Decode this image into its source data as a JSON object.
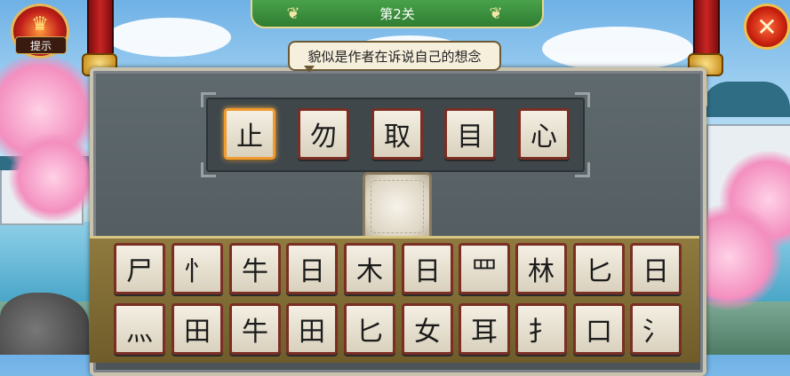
{
  "level": {
    "title": "第2关"
  },
  "hint": {
    "text": "貌似是作者在诉说自己的想念"
  },
  "tip_button": {
    "label": "提示",
    "icon": "trophy-icon"
  },
  "close_button": {
    "icon": "close-icon",
    "glyph": "✕"
  },
  "clue_tiles": [
    {
      "char": "止",
      "selected": true
    },
    {
      "char": "勿",
      "selected": false
    },
    {
      "char": "取",
      "selected": false
    },
    {
      "char": "目",
      "selected": false
    },
    {
      "char": "心",
      "selected": false
    }
  ],
  "answer_slots": [
    {
      "char": ""
    }
  ],
  "keyboard": {
    "row1": [
      "尸",
      "忄",
      "牛",
      "日",
      "木",
      "日",
      "罒",
      "林",
      "匕",
      "日"
    ],
    "row2": [
      "灬",
      "田",
      "牛",
      "田",
      "匕",
      "女",
      "耳",
      "扌",
      "口",
      "氵"
    ]
  },
  "colors": {
    "accent": "#f19a2e",
    "tile_border": "#7a2e24",
    "banner": "#2f7d32"
  }
}
